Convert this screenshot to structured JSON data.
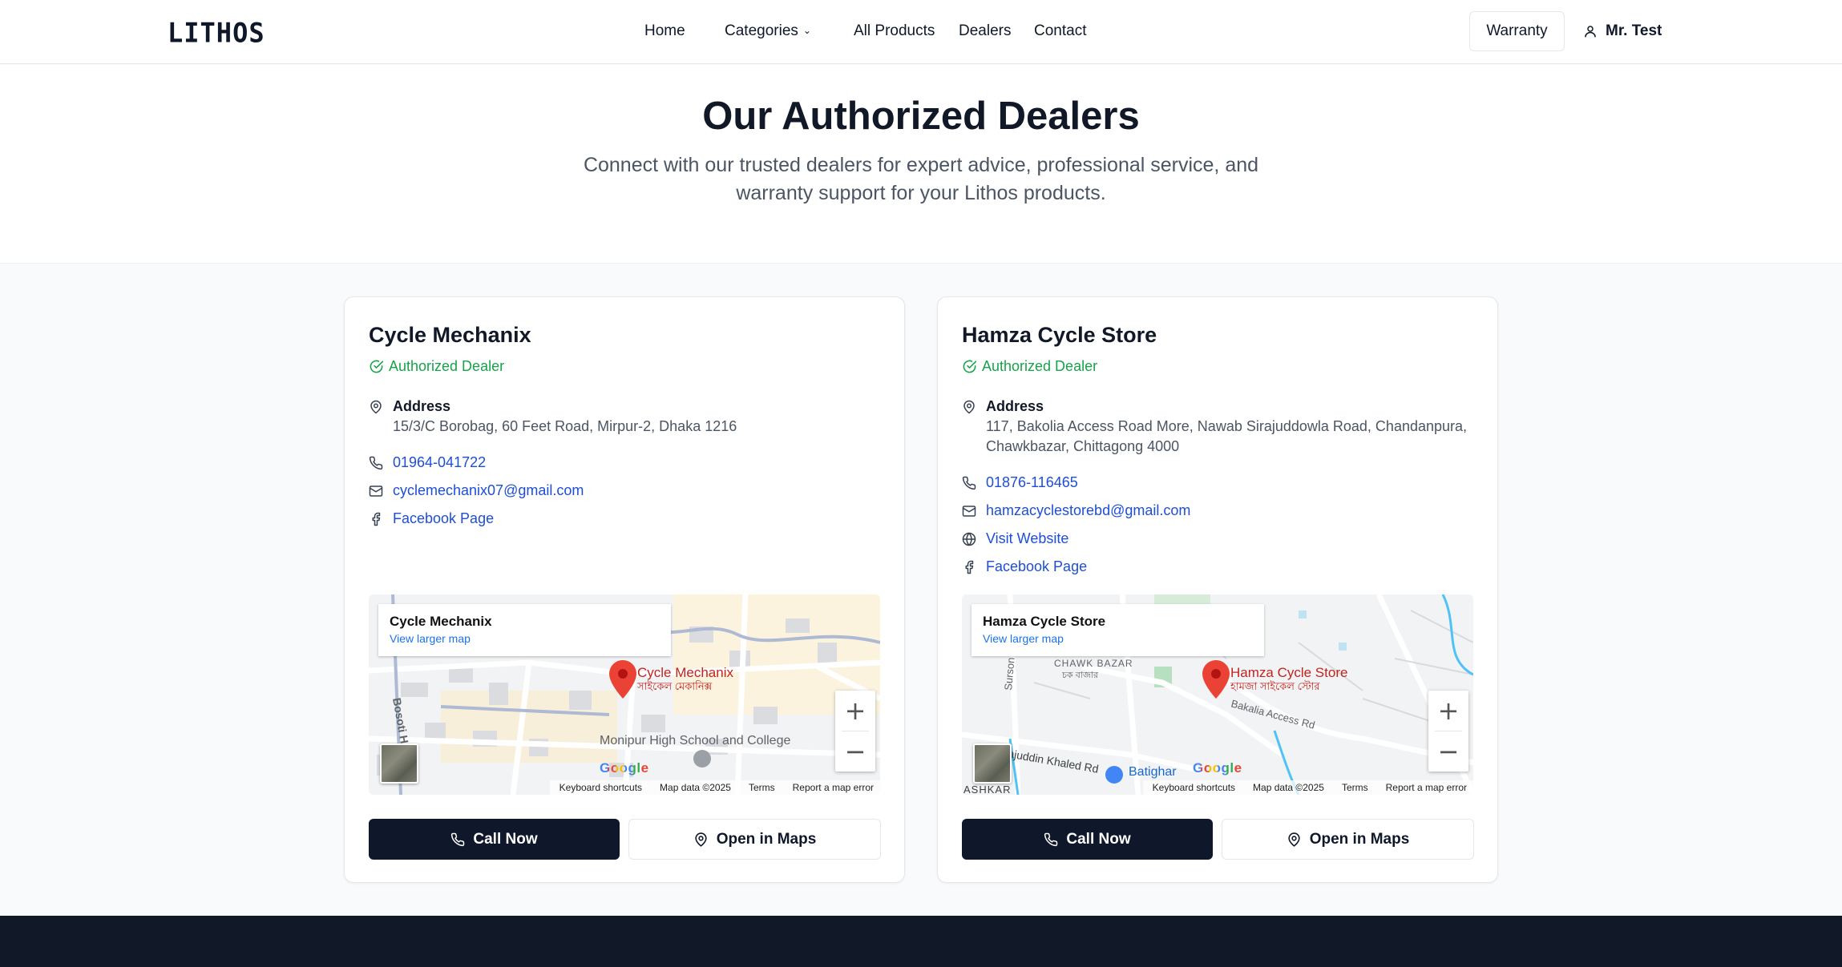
{
  "header": {
    "logo": "LITHOS",
    "nav": {
      "home": "Home",
      "categories": "Categories",
      "all_products": "All Products",
      "dealers": "Dealers",
      "contact": "Contact"
    },
    "warranty_label": "Warranty",
    "user_name": "Mr. Test"
  },
  "hero": {
    "title": "Our Authorized Dealers",
    "subtitle": "Connect with our trusted dealers for expert advice, professional service, and warranty support for your Lithos products."
  },
  "dealers": [
    {
      "name": "Cycle Mechanix",
      "badge": "Authorized Dealer",
      "address_label": "Address",
      "address": "15/3/C Borobag, 60 Feet Road, Mirpur-2, Dhaka 1216",
      "phone": "01964-041722",
      "email": "cyclemechanix07@gmail.com",
      "facebook": "Facebook Page",
      "map": {
        "place_name": "Cycle Mechanix",
        "view_larger": "View larger map",
        "pin_label": "Cycle Mechanix",
        "pin_label_bn": "সাইকেল মেকানিক্স",
        "poi": "Monipur High School and College",
        "road_label": "Bosoti Hou",
        "google": "Google",
        "shortcuts": "Keyboard shortcuts",
        "map_data": "Map data ©2025",
        "terms": "Terms",
        "report": "Report a map error"
      },
      "call_label": "Call Now",
      "maps_label": "Open in Maps"
    },
    {
      "name": "Hamza Cycle Store",
      "badge": "Authorized Dealer",
      "address_label": "Address",
      "address": "117, Bakolia Access Road More, Nawab Sirajuddowla Road, Chandanpura, Chawkbazar, Chittagong 4000",
      "phone": "01876-116465",
      "email": "hamzacyclestorebd@gmail.com",
      "website": "Visit Website",
      "facebook": "Facebook Page",
      "map": {
        "place_name": "Hamza Cycle Store",
        "view_larger": "View larger map",
        "pin_label": "Hamza Cycle Store",
        "pin_label_bn": "হামজা সাইকেল স্টোর",
        "area": "CHAWK BAZAR",
        "area_bn": "চক বাজার",
        "poi": "Batighar",
        "road1": "Bakalia Access Rd",
        "road2": "Sirajuddin Khaled Rd",
        "road3": "Surson R",
        "road4": "ASHKAR",
        "google": "Google",
        "shortcuts": "Keyboard shortcuts",
        "map_data": "Map data ©2025",
        "terms": "Terms",
        "report": "Report a map error"
      },
      "call_label": "Call Now",
      "maps_label": "Open in Maps"
    }
  ]
}
